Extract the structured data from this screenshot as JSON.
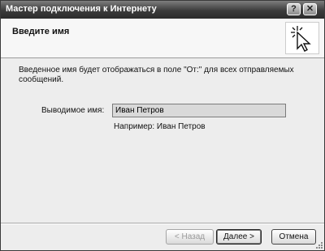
{
  "window": {
    "title": "Мастер подключения к Интернету",
    "help_glyph": "?",
    "close_glyph": "✕"
  },
  "header": {
    "title": "Введите имя",
    "icon": "wizard-cursor-icon"
  },
  "main": {
    "description": "Введенное имя будет отображаться в поле \"От:\" для всех отправляемых сообщений.",
    "field_label": "Выводимое имя:",
    "field_value": "Иван Петров",
    "example": "Например: Иван Петров"
  },
  "buttons": {
    "back": "< Назад",
    "next": "Далее >",
    "cancel": "Отмена"
  }
}
